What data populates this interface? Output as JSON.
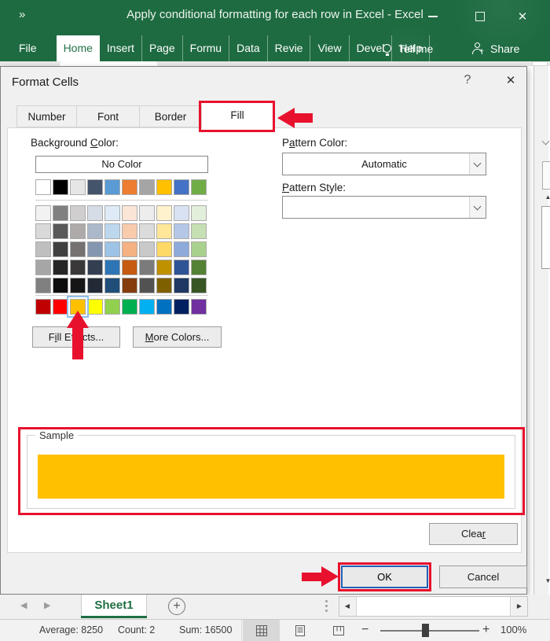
{
  "window": {
    "title": "Apply conditional formatting for each row in Excel - Excel",
    "collapse_chevrons": "»"
  },
  "ribbon": {
    "tabs": [
      "File",
      "Home",
      "Insert",
      "Page",
      "Formu",
      "Data",
      "Revie",
      "View",
      "Devel",
      "Help"
    ],
    "active_tab": "Home",
    "tell_me_label": "Tell me",
    "share_label": "Share"
  },
  "dialog": {
    "title": "Format Cells",
    "help_glyph": "?",
    "close_glyph": "✕",
    "tabs": [
      "Number",
      "Font",
      "Border",
      "Fill"
    ],
    "active_tab": "Fill",
    "labels": {
      "background_color": {
        "pre": "Background ",
        "accel": "C",
        "post": "olor:"
      },
      "pattern_color": {
        "pre": "P",
        "accel": "a",
        "post": "ttern Color:"
      },
      "pattern_style": {
        "pre": "",
        "accel": "P",
        "post": "attern Style:"
      },
      "fill_effects": {
        "pre": "F",
        "accel": "i",
        "post": "ll Effects..."
      },
      "more_colors": {
        "pre": "",
        "accel": "M",
        "post": "ore Colors..."
      },
      "clear": {
        "pre": "Clea",
        "accel": "r",
        "post": ""
      }
    },
    "no_color_label": "No Color",
    "pattern_color_value": "Automatic",
    "pattern_style_value": "",
    "sample_label": "Sample",
    "sample_color": "#FFC000",
    "ok_label": "OK",
    "cancel_label": "Cancel",
    "palette": {
      "theme_row": [
        "#FFFFFF",
        "#000000",
        "#E7E6E6",
        "#44546A",
        "#5B9BD5",
        "#ED7D31",
        "#A5A5A5",
        "#FFC000",
        "#4472C4",
        "#70AD47"
      ],
      "tint_rows": [
        [
          "#F2F2F2",
          "#808080",
          "#D0CECE",
          "#D6DCE5",
          "#DEEBF7",
          "#FBE5D6",
          "#EDEDED",
          "#FFF2CC",
          "#D9E2F3",
          "#E2EFDA"
        ],
        [
          "#D9D9D9",
          "#595959",
          "#AEAAAA",
          "#ACB9CA",
          "#BDD7EE",
          "#F8CBAD",
          "#DBDBDB",
          "#FFE699",
          "#B4C7E7",
          "#C6E0B4"
        ],
        [
          "#BFBFBF",
          "#404040",
          "#757171",
          "#8496B0",
          "#9DC3E6",
          "#F4B183",
          "#C9C9C9",
          "#FFD966",
          "#8EAADB",
          "#A9D18E"
        ],
        [
          "#A6A6A6",
          "#262626",
          "#3A3838",
          "#333F50",
          "#2E75B6",
          "#C55A11",
          "#7B7B7B",
          "#BF9000",
          "#2F5496",
          "#548235"
        ],
        [
          "#808080",
          "#0D0D0D",
          "#161616",
          "#222B35",
          "#1F4E79",
          "#843C0C",
          "#525252",
          "#7F6000",
          "#1F3864",
          "#375623"
        ]
      ],
      "standard_row": [
        "#C00000",
        "#FF0000",
        "#FFC000",
        "#FFFF00",
        "#92D050",
        "#00B050",
        "#00B0F0",
        "#0070C0",
        "#002060",
        "#7030A0"
      ],
      "selected_standard_index": 2
    },
    "annotations": {
      "color": "#E8112D",
      "highlights": [
        "fill-tab",
        "selected-standard-color",
        "sample-area",
        "ok-button"
      ]
    }
  },
  "sheet_bar": {
    "sheet_tab": "Sheet1",
    "add_sheet_glyph": "+"
  },
  "status_bar": {
    "average": "Average: 8250",
    "count": "Count: 2",
    "sum": "Sum: 16500",
    "zoom_level": "100%",
    "views": [
      "normal",
      "page-layout",
      "page-break-preview"
    ],
    "active_view": "normal"
  }
}
